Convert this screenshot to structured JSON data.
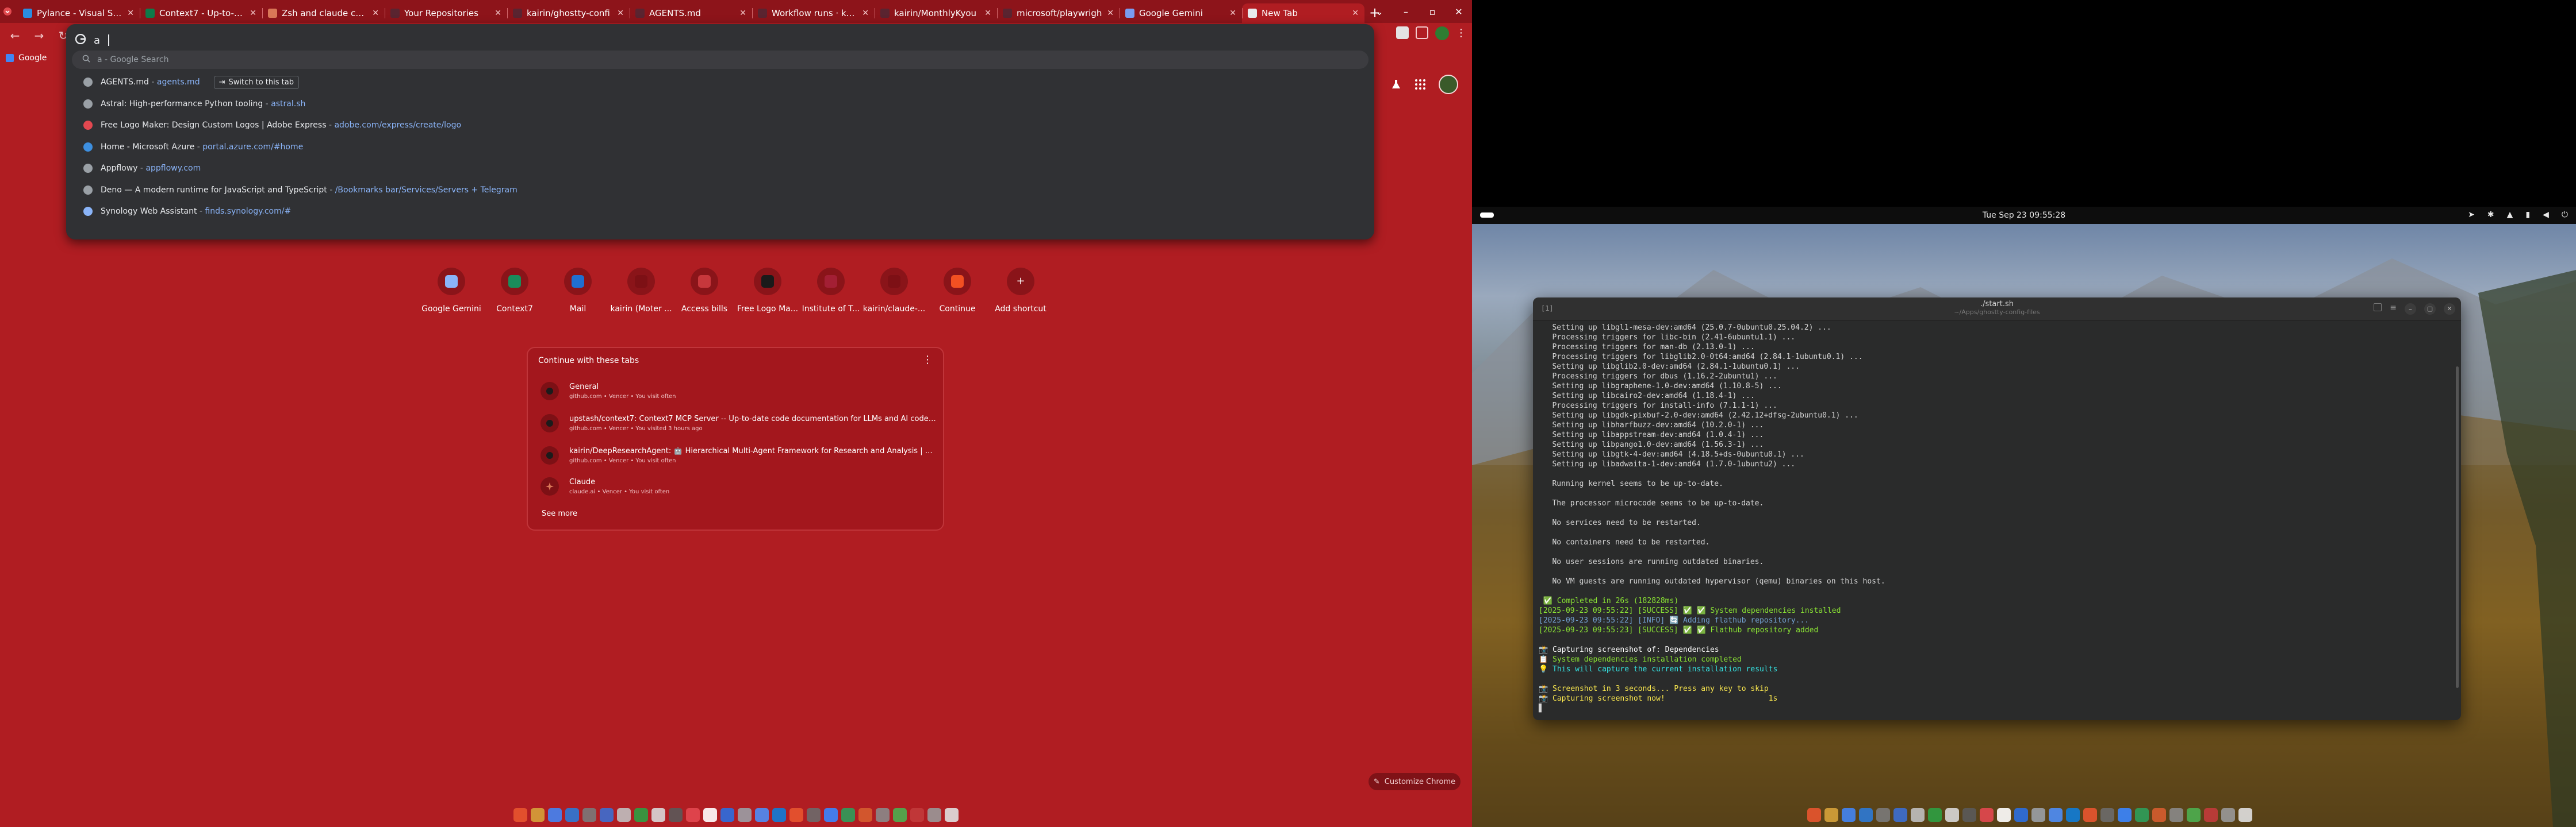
{
  "chrome": {
    "tabs": [
      {
        "label": "Pylance - Visual Stud",
        "favicon": "vscode-icon",
        "color": "#2b8de0"
      },
      {
        "label": "Context7 - Up-to-dat",
        "favicon": "context7-icon",
        "color": "#0e7a4a"
      },
      {
        "label": "Zsh and claude comm",
        "favicon": "claude-icon",
        "color": "#d97757"
      },
      {
        "label": "Your Repositories",
        "favicon": "repo-icon",
        "color": "#5a2430"
      },
      {
        "label": "kairin/ghostty-confi",
        "favicon": "github-icon",
        "color": "#5a2430"
      },
      {
        "label": "AGENTS.md",
        "favicon": "github-icon",
        "color": "#5a2430"
      },
      {
        "label": "Workflow runs · kairi",
        "favicon": "github-icon",
        "color": "#5a2430"
      },
      {
        "label": "kairin/MonthlyKyou",
        "favicon": "github-icon",
        "color": "#5a2430"
      },
      {
        "label": "microsoft/playwrigh",
        "favicon": "github-icon",
        "color": "#5a2430"
      },
      {
        "label": "Google Gemini",
        "favicon": "gemini-icon",
        "color": "#7a9cf0"
      },
      {
        "label": "New Tab",
        "favicon": "chrome-icon",
        "color": "#e8eaed",
        "active": true
      }
    ],
    "omnibox": {
      "typed": "a",
      "suggestion_hint": "a - Google Search",
      "rows": [
        {
          "title": "AGENTS.md",
          "sep": " - ",
          "url": "agents.md",
          "switch": "Switch to this tab",
          "icon": "tab-icon"
        },
        {
          "title": "Astral: High-performance Python tooling",
          "sep": " - ",
          "url": "astral.sh",
          "icon": "globe-icon"
        },
        {
          "title": "Free Logo Maker: Design Custom Logos | Adobe Express",
          "sep": " - ",
          "url": "adobe.com/express/create/logo",
          "icon": "adobe-icon"
        },
        {
          "title": "Home - Microsoft Azure",
          "sep": " - ",
          "url": "portal.azure.com/#home",
          "icon": "azure-icon"
        },
        {
          "title": "Appflowy",
          "sep": " - ",
          "url": "appflowy.com",
          "icon": "globe-icon"
        },
        {
          "title": "Deno — A modern runtime for JavaScript and TypeScript",
          "sep": " - ",
          "url": "/Bookmarks bar/Services/Servers + Telegram",
          "icon": "bookmark-icon"
        },
        {
          "title": "Synology Web Assistant",
          "sep": " - ",
          "url": "finds.synology.com/#",
          "icon": "synology-icon"
        }
      ]
    },
    "bookmarks": [
      {
        "label": "Google"
      }
    ],
    "shortcuts": [
      {
        "label": "Google Gemini",
        "icon": "gemini-icon",
        "color": "#8ab4f8"
      },
      {
        "label": "Context7",
        "icon": "context7-icon",
        "color": "#1a8c5b"
      },
      {
        "label": "Mail",
        "icon": "outlook-icon",
        "color": "#1f6fd1"
      },
      {
        "label": "kairin (Moter ...",
        "icon": "github-icon",
        "color": "#7d1015"
      },
      {
        "label": "Access bills",
        "icon": "google-icon",
        "color": "#c7373c"
      },
      {
        "label": "Free Logo Ma...",
        "icon": "adobe-icon",
        "color": "#1a1a1a"
      },
      {
        "label": "Institute of T...",
        "icon": "mit-icon",
        "color": "#a31f34"
      },
      {
        "label": "kairin/claude-...",
        "icon": "github-icon",
        "color": "#7d1015"
      },
      {
        "label": "Continue",
        "icon": "windows-icon",
        "color": "#f25022"
      },
      {
        "label": "Add shortcut",
        "icon": "plus-icon",
        "color": "#8a1419"
      }
    ],
    "continue": {
      "heading": "Continue with these tabs",
      "rows": [
        {
          "title": "General",
          "sub": "github.com • Vencer • You visit often"
        },
        {
          "title": "upstash/context7: Context7 MCP Server -- Up-to-date code documentation for LLMs and AI code editors",
          "sub": "github.com • Vencer • You visited 3 hours ago"
        },
        {
          "title": "kairin/DeepResearchAgent: 🤖 Hierarchical Multi-Agent Framework for Research and Analysis | TLS Develop...",
          "sub": "github.com • Vencer • You visit often"
        },
        {
          "title": "Claude",
          "sub": "claude.ai • Vencer • You visit often"
        }
      ],
      "see_more": "See more"
    },
    "customize_label": "Customize Chrome"
  },
  "desktop": {
    "clock": "Tue Sep 23  09:55:28",
    "terminal": {
      "title": "./start.sh",
      "subtitle": "~/Apps/ghostty-config-files",
      "tab_number": "[1]",
      "lines": [
        {
          "t": "   Setting up libgl1-mesa-dev:amd64 (25.0.7-0ubuntu0.25.04.2) ...",
          "c": ""
        },
        {
          "t": "   Processing triggers for libc-bin (2.41-6ubuntu1.1) ...",
          "c": ""
        },
        {
          "t": "   Processing triggers for man-db (2.13.0-1) ...",
          "c": ""
        },
        {
          "t": "   Processing triggers for libglib2.0-0t64:amd64 (2.84.1-1ubuntu0.1) ...",
          "c": ""
        },
        {
          "t": "   Setting up libglib2.0-dev:amd64 (2.84.1-1ubuntu0.1) ...",
          "c": ""
        },
        {
          "t": "   Processing triggers for dbus (1.16.2-2ubuntu1) ...",
          "c": ""
        },
        {
          "t": "   Setting up libgraphene-1.0-dev:amd64 (1.10.8-5) ...",
          "c": ""
        },
        {
          "t": "   Setting up libcairo2-dev:amd64 (1.18.4-1) ...",
          "c": ""
        },
        {
          "t": "   Processing triggers for install-info (7.1.1-1) ...",
          "c": ""
        },
        {
          "t": "   Setting up libgdk-pixbuf-2.0-dev:amd64 (2.42.12+dfsg-2ubuntu0.1) ...",
          "c": ""
        },
        {
          "t": "   Setting up libharfbuzz-dev:amd64 (10.2.0-1) ...",
          "c": ""
        },
        {
          "t": "   Setting up libappstream-dev:amd64 (1.0.4-1) ...",
          "c": ""
        },
        {
          "t": "   Setting up libpango1.0-dev:amd64 (1.56.3-1) ...",
          "c": ""
        },
        {
          "t": "   Setting up libgtk-4-dev:amd64 (4.18.5+ds-0ubuntu0.1) ...",
          "c": ""
        },
        {
          "t": "   Setting up libadwaita-1-dev:amd64 (1.7.0-1ubuntu2) ...",
          "c": ""
        },
        {
          "t": "",
          "c": ""
        },
        {
          "t": "   Running kernel seems to be up-to-date.",
          "c": ""
        },
        {
          "t": "",
          "c": ""
        },
        {
          "t": "   The processor microcode seems to be up-to-date.",
          "c": ""
        },
        {
          "t": "",
          "c": ""
        },
        {
          "t": "   No services need to be restarted.",
          "c": ""
        },
        {
          "t": "",
          "c": ""
        },
        {
          "t": "   No containers need to be restarted.",
          "c": ""
        },
        {
          "t": "",
          "c": ""
        },
        {
          "t": "   No user sessions are running outdated binaries.",
          "c": ""
        },
        {
          "t": "",
          "c": ""
        },
        {
          "t": "   No VM guests are running outdated hypervisor (qemu) binaries on this host.",
          "c": ""
        },
        {
          "t": "",
          "c": ""
        },
        {
          "t": " ✅ Completed in 26s (182828ms)",
          "c": "gl"
        },
        {
          "t": "[2025-09-23 09:55:22] [SUCCESS] ✅ ✅ System dependencies installed",
          "c": "gl"
        },
        {
          "t": "[2025-09-23 09:55:22] [INFO] 🔄 Adding flathub repository...",
          "c": "bl"
        },
        {
          "t": "[2025-09-23 09:55:23] [SUCCESS] ✅ ✅ Flathub repository added",
          "c": "gl"
        },
        {
          "t": "",
          "c": ""
        },
        {
          "t": "📸 Capturing screenshot of: Dependencies",
          "c": "wh"
        },
        {
          "t": "📋 System dependencies installation completed",
          "c": "gl"
        },
        {
          "t": "💡 This will capture the current installation results",
          "c": "cy"
        },
        {
          "t": "",
          "c": ""
        },
        {
          "t": "📸 Screenshot in 3 seconds... Press any key to skip",
          "c": "yl"
        },
        {
          "t": "📸 Capturing screenshot now!                       1s",
          "c": "yl"
        },
        {
          "t": "▋",
          "c": ""
        }
      ]
    }
  }
}
